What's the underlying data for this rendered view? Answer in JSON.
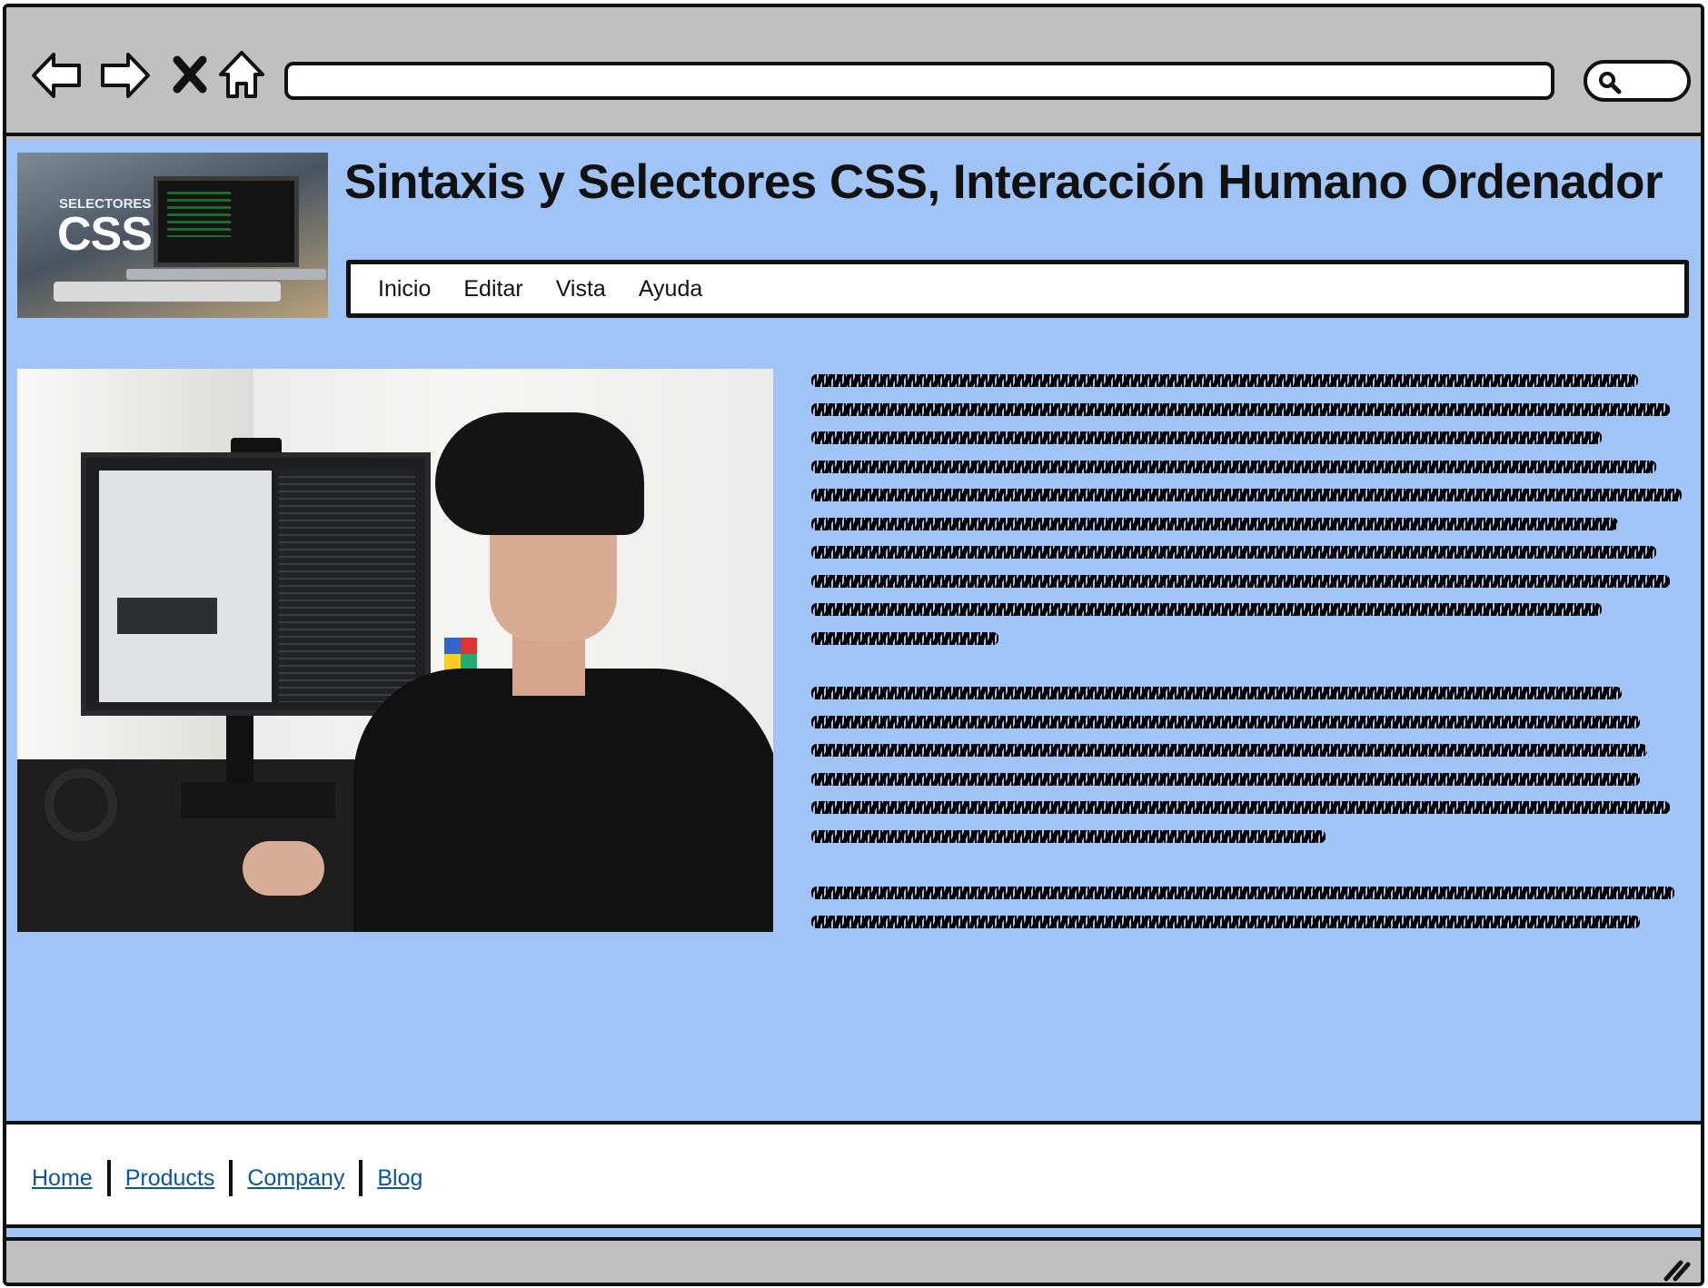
{
  "browser": {
    "back_icon": "back-arrow-icon",
    "forward_icon": "forward-arrow-icon",
    "stop_icon": "close-icon",
    "home_icon": "home-icon",
    "url_value": "",
    "search_icon": "search-icon"
  },
  "header": {
    "logo_subtitle": "SELECTORES",
    "logo_title": "CSS",
    "title": "Sintaxis y Selectores CSS, Interacción Humano Ordenador"
  },
  "menu": {
    "items": [
      {
        "label": "Inicio"
      },
      {
        "label": "Editar"
      },
      {
        "label": "Vista"
      },
      {
        "label": "Ayuda"
      }
    ]
  },
  "content": {
    "image_icon": "person-at-computer-photo",
    "paragraphs_lines": [
      10,
      6,
      2
    ]
  },
  "footer": {
    "links": [
      {
        "label": "Home"
      },
      {
        "label": "Products"
      },
      {
        "label": "Company"
      },
      {
        "label": "Blog"
      }
    ]
  },
  "colors": {
    "page_background": "#a0c4f5",
    "chrome": "#c0c0c0",
    "link": "#0a57a0"
  }
}
